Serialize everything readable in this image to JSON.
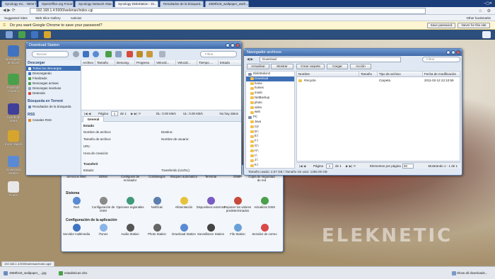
{
  "browser": {
    "tabs": [
      {
        "label": "Synology Inc. - NEW NAS..."
      },
      {
        "label": "OpenOffice.org Forum - Ve..."
      },
      {
        "label": "Synology Network Attac..."
      },
      {
        "label": "Synology DiskStation - Di..."
      },
      {
        "label": "Resultados de la búsqued..."
      },
      {
        "label": "4869f4c8_wallpaper_warh..."
      }
    ],
    "url": "192.168.1.4:5000/webman/index.cgi",
    "bookmarks": [
      "Suggested Sites",
      "Web Slice Gallery",
      "noticias"
    ],
    "other_bookmarks": "Other bookmarks",
    "infobar": {
      "message": "Do you want Google Chrome to save your password?",
      "save": "Save password",
      "never": "Never for this site"
    }
  },
  "desktop_icons": [
    {
      "label": "Navegador archivos",
      "color": "#3f73c2"
    },
    {
      "label": "Panel de control",
      "color": "#4aa04a"
    },
    {
      "label": "Ayuda de DSM",
      "color": "#3f3f9a"
    },
    {
      "label": "Inicio rápido",
      "color": "#d8a52c"
    },
    {
      "label": "Download Station",
      "color": "#5a8ad4"
    },
    {
      "label": "Notas",
      "color": "#e8e8e8"
    }
  ],
  "download_station": {
    "title": "Download Station",
    "search_placeholder": "Buscar",
    "filter_placeholder": "Filtrar",
    "sidebar": {
      "group1": "Descargar",
      "items1": [
        "Todas las descargas",
        "Descargando",
        "Finalizado",
        "Descargas activas",
        "Descargas inactivas",
        "Detenido"
      ],
      "group2": "Búsqueda en Torrent",
      "items2": [
        "Resultados de la búsqueda"
      ],
      "group3": "RSS",
      "items3": [
        "Canales RSS"
      ]
    },
    "columns": [
      "Archivo",
      "Tamaño",
      "Descarg.",
      "Progreso",
      "Velocid...",
      "Velocid...",
      "Tiempo ...",
      "Estado"
    ],
    "pager": {
      "page": "Página",
      "page_value": "1",
      "of": "de 1",
      "dl": "DL: 0.00 KB/s",
      "ul": "UL: 0.00 KB/s",
      "empty": "No hay datos"
    },
    "tab_general": "General",
    "estado_section": "Estado",
    "fields": {
      "nombre_archivo": "Nombre de archivo:",
      "destino": "Destino:",
      "tamano_archivo": "Tamaño de archivo:",
      "nombre_usuario": "Nombre de usuario:",
      "url": "URL:",
      "hora_creacion": "Hora de creación:"
    },
    "transfer_section": "Transferir",
    "estado_label": "Estado:",
    "transferido_label": "Transferido (UL/DL):"
  },
  "file_browser": {
    "title": "Navegador archivos",
    "path": "Download",
    "filter_placeholder": "Filtrar",
    "buttons": [
      "Actualizar",
      "Mostrar",
      "Crear carpeta",
      "Cargar",
      "Acción"
    ],
    "tree": [
      "DiskStation2",
      "Download",
      "home",
      "homes",
      "music",
      "NetBackup",
      "photo",
      "video",
      "web",
      "PC",
      "Java",
      "Cd",
      "D:\\",
      "E:\\",
      "F:\\",
      "G:\\",
      "H:\\",
      "I:\\",
      "J:\\",
      "K:\\"
    ],
    "columns": [
      "Nombre",
      "Tamaño",
      "Tipo de archivo",
      "Fecha de modificación"
    ],
    "rows": [
      {
        "name": "#recycle",
        "size": "",
        "type": "Carpeta",
        "date": "2011-02-12 22:10:59"
      }
    ],
    "pager": {
      "page": "Página",
      "page_value": "1",
      "of": "de 1",
      "items_label": "Elementos por página",
      "items_value": "50",
      "range": "Mostrando 1 - 1 de 1"
    },
    "status": "Tamaño usado: 2.67 GB / Tamaño sin usar: 1356.06 GB"
  },
  "control_panel": {
    "row1": [
      "Servicios Web",
      "DDNS",
      "Configurar de enrutador",
      "Cortafuegos",
      "Bloqueo automático",
      "Terminal",
      "SNMP",
      "Copia de seguridad de red"
    ],
    "sistema": "Sistema",
    "row2": [
      "Red",
      "Configuración de DSM",
      "Opciones regionales",
      "Notificac",
      "Alimentación",
      "Dispositivos externos",
      "Reponer los valores predeterminados",
      "Actualizar DSM"
    ],
    "app_settings": "Configuración de la aplicación",
    "row3": [
      "Servidor multimedia",
      "iTunes",
      "Audio Station",
      "Photo Station",
      "Download Station",
      "Surveillance Station",
      "File Station",
      "Servidor de correo"
    ]
  },
  "statusbar": {
    "url": "192.168.1.4:5000/webman/index.cgi#",
    "downloads": [
      "4869f4c8_wallpaper_...jpg",
      "estadisticas.xlsx"
    ],
    "show_all": "Show all downloads..."
  },
  "watermark": "ELEKNETIC"
}
